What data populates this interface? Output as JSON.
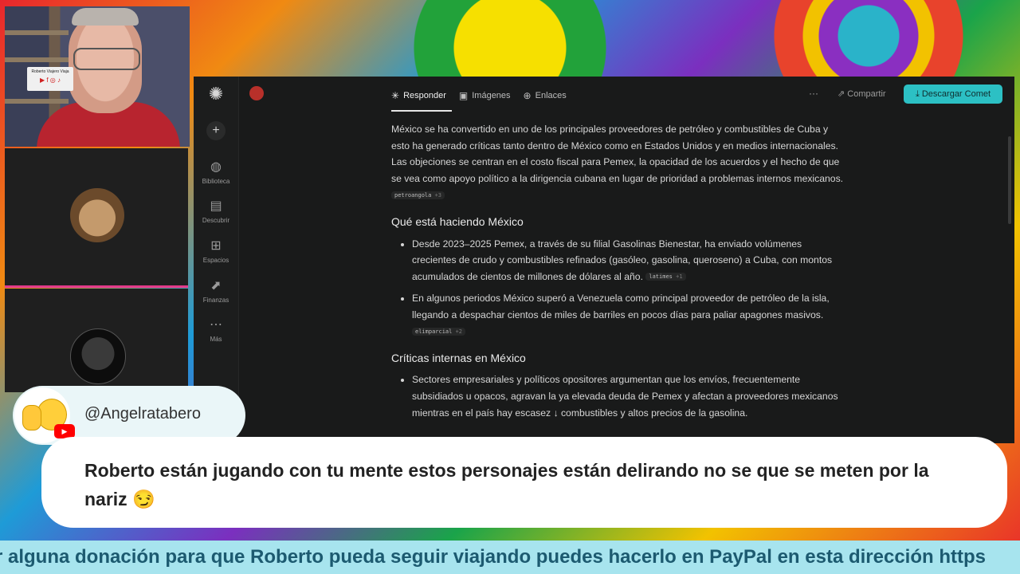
{
  "webcam": {
    "sign_text": "Roberto Viajero Viaja",
    "sign_icons": "▶ f ◎ ♪"
  },
  "sidebar": {
    "items": [
      {
        "icon": "globe-icon",
        "glyph": "◍",
        "label": "Biblioteca"
      },
      {
        "icon": "discover-icon",
        "glyph": "▤",
        "label": "Descubrir"
      },
      {
        "icon": "spaces-icon",
        "glyph": "⊞",
        "label": "Espacios"
      },
      {
        "icon": "finance-icon",
        "glyph": "⬈",
        "label": "Finanzas"
      },
      {
        "icon": "more-icon",
        "glyph": "⋯",
        "label": "Más"
      }
    ]
  },
  "tabs": [
    {
      "label": "Responder",
      "glyph": "✳"
    },
    {
      "label": "Imágenes",
      "glyph": "▣"
    },
    {
      "label": "Enlaces",
      "glyph": "⊕"
    }
  ],
  "toolbar": {
    "more": "···",
    "share": "⇗ Compartir",
    "download": "⤓ Descargar Comet"
  },
  "article": {
    "intro": "México se ha convertido en uno de los principales proveedores de petróleo y combustibles de Cuba y esto ha generado críticas tanto dentro de México como en Estados Unidos y en medios internacionales. Las objeciones se centran en el costo fiscal para Pemex, la opacidad de los acuerdos y el hecho de que se vea como apoyo político a la dirigencia cubana en lugar de prioridad a problemas internos mexicanos.",
    "intro_cite": "petroangola",
    "intro_cite_n": "+3",
    "h1": "Qué está haciendo México",
    "b1": "Desde 2023–2025 Pemex, a través de su filial Gasolinas Bienestar, ha enviado volúmenes crecientes de crudo y combustibles refinados (gasóleo, gasolina, queroseno) a Cuba, con montos acumulados de cientos de millones de dólares al año.",
    "b1_cite": "latimes",
    "b1_cite_n": "+1",
    "b2": "En algunos periodos México superó a Venezuela como principal proveedor de petróleo de la isla, llegando a despachar cientos de miles de barriles en pocos días para paliar apagones masivos.",
    "b2_cite": "elimparcial",
    "b2_cite_n": "+2",
    "h2": "Críticas internas en México",
    "b3": "Sectores empresariales y políticos opositores argumentan que los envíos, frecuentemente subsidiados u opacos, agravan la ya elevada deuda de Pemex y afectan a proveedores mexicanos mientras en el país hay escasez ↓ combustibles y altos precios de la gasolina."
  },
  "chat": {
    "username": "@Angelratabero",
    "message": "Roberto están jugando con tu mente estos personajes están delirando no se que se meten por la nariz 😏",
    "yt_badge": "▶"
  },
  "ticker": {
    "text": "r alguna donación para que Roberto pueda seguir viajando puedes hacerlo en PayPal en esta dirección https"
  }
}
